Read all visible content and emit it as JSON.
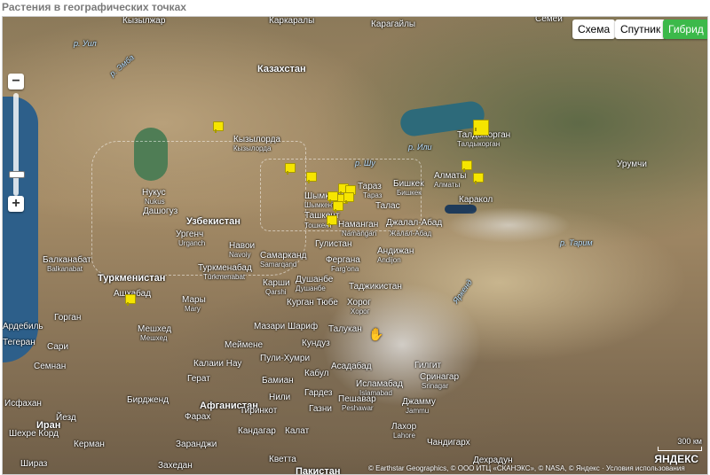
{
  "header": {
    "title": "Растения в географических точках"
  },
  "map_type": {
    "buttons": [
      {
        "label": "Схема",
        "active": false
      },
      {
        "label": "Спутник",
        "active": false
      },
      {
        "label": "Гибрид",
        "active": true
      }
    ]
  },
  "zoom": {
    "plus": "+",
    "minus": "−"
  },
  "labels": {
    "top": [
      "Кызылжар",
      "Каркаралы",
      "Семей",
      "Карагайлы"
    ],
    "countries": [
      "Казахстан",
      "Узбекистан",
      "Туркменистан",
      "Афганистан",
      "Иран",
      "Пакистан"
    ],
    "rivers": [
      "р. Уил",
      "р. Эмба",
      "р. Или",
      "р. Шу",
      "р. Тарим",
      "Яркенд"
    ],
    "cities": [
      {
        "name": "Кызылорда",
        "sub": "Кызылорда"
      },
      {
        "name": "Талдыкорган",
        "sub": "Талдыкорган"
      },
      {
        "name": "Урумчи",
        "sub": ""
      },
      {
        "name": "Алматы",
        "sub": "Алматы"
      },
      {
        "name": "Бишкек",
        "sub": "Бишкек"
      },
      {
        "name": "Тараз",
        "sub": "Тараз"
      },
      {
        "name": "Шымкент",
        "sub": "Шымкент"
      },
      {
        "name": "Нукус",
        "sub": "Nukus"
      },
      {
        "name": "Дашогуз",
        "sub": ""
      },
      {
        "name": "Ташкент",
        "sub": "Тошкент"
      },
      {
        "name": "Талас",
        "sub": ""
      },
      {
        "name": "Каракол",
        "sub": ""
      },
      {
        "name": "Джалал-Абад",
        "sub": "Жалал-Абад"
      },
      {
        "name": "Наманган",
        "sub": "Namangan"
      },
      {
        "name": "Ургенч",
        "sub": "Urganch"
      },
      {
        "name": "Навои",
        "sub": "Navoiy"
      },
      {
        "name": "Гулистан",
        "sub": ""
      },
      {
        "name": "Андижан",
        "sub": "Andijon"
      },
      {
        "name": "Фергана",
        "sub": "Farg'ona"
      },
      {
        "name": "Самарканд",
        "sub": "Samarqand"
      },
      {
        "name": "Туркменабад",
        "sub": "Türkmenabat"
      },
      {
        "name": "Душанбе",
        "sub": "Душанбе"
      },
      {
        "name": "Карши",
        "sub": "Qarshi"
      },
      {
        "name": "Таджикистан",
        "sub": ""
      },
      {
        "name": "Балканабат",
        "sub": "Balkanabat"
      },
      {
        "name": "Ашхабад",
        "sub": ""
      },
      {
        "name": "Мары",
        "sub": "Mary"
      },
      {
        "name": "Курган Тюбе",
        "sub": ""
      },
      {
        "name": "Хорог",
        "sub": "Хорог"
      },
      {
        "name": "Горган",
        "sub": ""
      },
      {
        "name": "Мазари Шариф",
        "sub": ""
      },
      {
        "name": "Талукан",
        "sub": ""
      },
      {
        "name": "Мешхед",
        "sub": "Мешхед"
      },
      {
        "name": "Мейменe",
        "sub": ""
      },
      {
        "name": "Кундуз",
        "sub": ""
      },
      {
        "name": "Сари",
        "sub": ""
      },
      {
        "name": "Семнан",
        "sub": ""
      },
      {
        "name": "Пули-Хумри",
        "sub": ""
      },
      {
        "name": "Калаии Нау",
        "sub": ""
      },
      {
        "name": "Бамиан",
        "sub": ""
      },
      {
        "name": "Асадабад",
        "sub": ""
      },
      {
        "name": "Гилгит",
        "sub": ""
      },
      {
        "name": "Сринагар",
        "sub": "Srinagar"
      },
      {
        "name": "Герат",
        "sub": ""
      },
      {
        "name": "Кабул",
        "sub": ""
      },
      {
        "name": "Исламабад",
        "sub": "Islamabad"
      },
      {
        "name": "Исфахан",
        "sub": ""
      },
      {
        "name": "Бирдженд",
        "sub": ""
      },
      {
        "name": "Нили",
        "sub": ""
      },
      {
        "name": "Гардез",
        "sub": ""
      },
      {
        "name": "Пешавар",
        "sub": "Peshawar"
      },
      {
        "name": "Джамму",
        "sub": "Jammu"
      },
      {
        "name": "Йезд",
        "sub": ""
      },
      {
        "name": "Фарах",
        "sub": ""
      },
      {
        "name": "Тиринкот",
        "sub": ""
      },
      {
        "name": "Газни",
        "sub": ""
      },
      {
        "name": "Шехре Корд",
        "sub": ""
      },
      {
        "name": "Лахор",
        "sub": "Lahore"
      },
      {
        "name": "Кандагар",
        "sub": ""
      },
      {
        "name": "Калат",
        "sub": ""
      },
      {
        "name": "Керман",
        "sub": ""
      },
      {
        "name": "Заранджи",
        "sub": ""
      },
      {
        "name": "Шираз",
        "sub": ""
      },
      {
        "name": "Захедан",
        "sub": ""
      },
      {
        "name": "Кветта",
        "sub": ""
      },
      {
        "name": "Чандигарх",
        "sub": ""
      },
      {
        "name": "Дехрадун",
        "sub": ""
      },
      {
        "name": "Тегеран",
        "sub": ""
      },
      {
        "name": "Ардебиль",
        "sub": ""
      }
    ]
  },
  "footer": {
    "attribution": "© Earthstar Geographics, © ООО ИТЦ «СКАНЭКС», © NASA, © Яндекс · Условия использования",
    "scale": "300 км",
    "brand": "ЯНДЕКС"
  },
  "markers_count": 14
}
